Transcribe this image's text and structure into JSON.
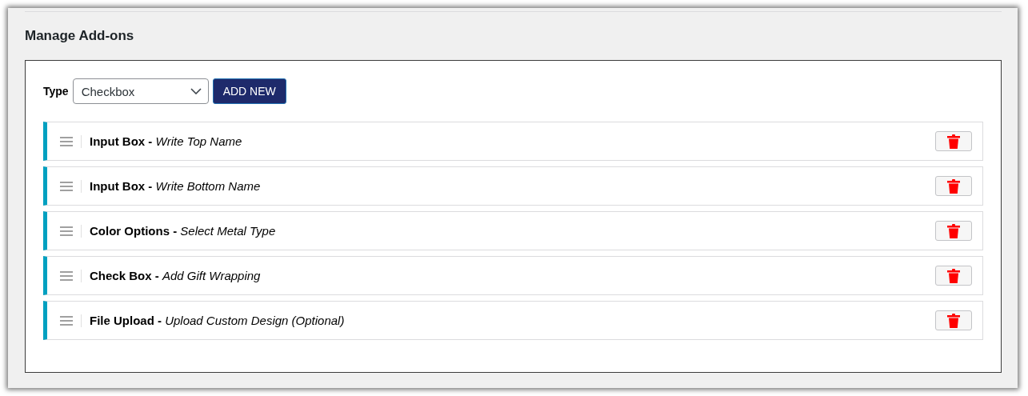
{
  "heading": "Manage Add-ons",
  "type_label": "Type",
  "type_select": {
    "value": "Checkbox"
  },
  "add_button": "ADD NEW",
  "addons": [
    {
      "text": "**Input Box -** *Write Top Name*"
    },
    {
      "text": "**Input Box -** *Write Bottom Name*"
    },
    {
      "text": "**Color Options -** *Select Metal Type*"
    },
    {
      "text": "**Check Box -** *Add Gift Wrapping*"
    },
    {
      "text": "**File Upload -** *Upload Custom Design (Optional)*"
    }
  ]
}
